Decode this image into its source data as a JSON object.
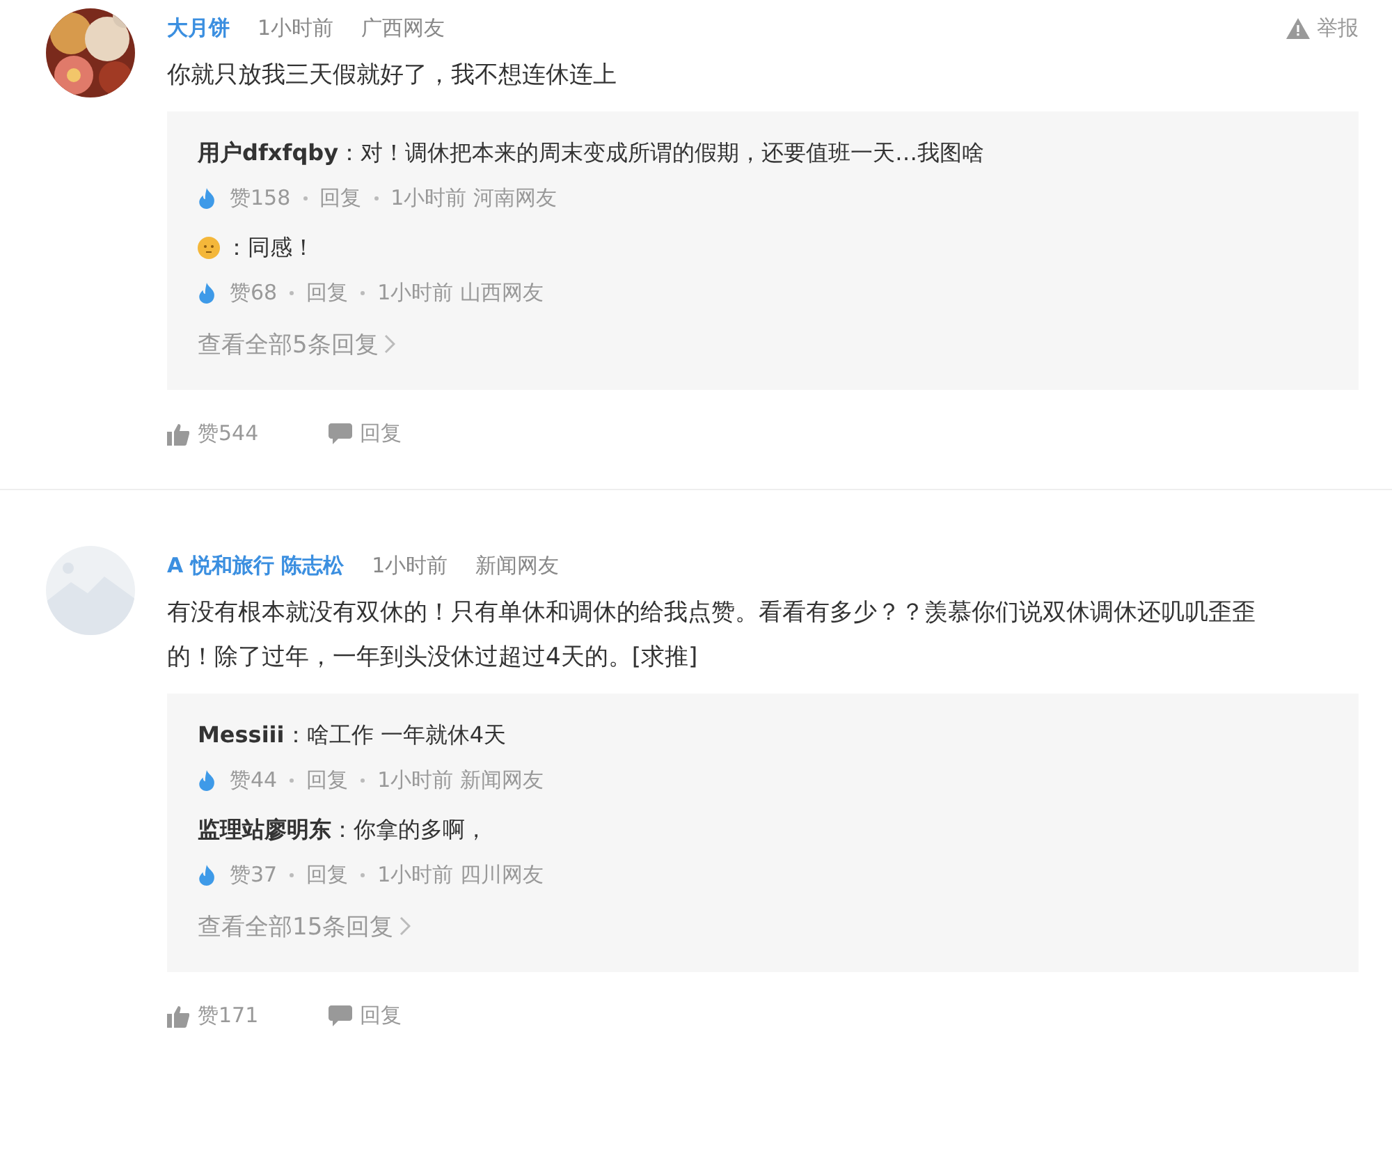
{
  "comments": [
    {
      "author": "大月饼",
      "time": "1小时前",
      "location": "广西网友",
      "report": "举报",
      "body": "你就只放我三天假就好了，我不想连休连上",
      "replies": [
        {
          "kind": "user",
          "author": "用户dfxfqby",
          "text": "：对！调休把本来的周末变成所谓的假期，还要值班一天…我图啥",
          "likes": "赞158",
          "reply": "回复",
          "time": "1小时前",
          "location": "河南网友"
        },
        {
          "kind": "emoji",
          "text": "：同感！",
          "likes": "赞68",
          "reply": "回复",
          "time": "1小时前",
          "location": "山西网友"
        }
      ],
      "more": "查看全部5条回复",
      "likes": "赞544",
      "reply": "回复"
    },
    {
      "author": "A 悦和旅行 陈志松",
      "time": "1小时前",
      "location": "新闻网友",
      "body": "有没有根本就没有双休的！只有单休和调休的给我点赞。看看有多少？？羡慕你们说双休调休还叽叽歪歪的！除了过年，一年到头没休过超过4天的。[求推]",
      "replies": [
        {
          "kind": "user",
          "author": "Messiii",
          "text": "：啥工作 一年就休4天",
          "likes": "赞44",
          "reply": "回复",
          "time": "1小时前",
          "location": "新闻网友"
        },
        {
          "kind": "user",
          "author": "监理站廖明东",
          "text": "：你拿的多啊，",
          "likes": "赞37",
          "reply": "回复",
          "time": "1小时前",
          "location": "四川网友"
        }
      ],
      "more": "查看全部15条回复",
      "likes": "赞171",
      "reply": "回复"
    }
  ]
}
